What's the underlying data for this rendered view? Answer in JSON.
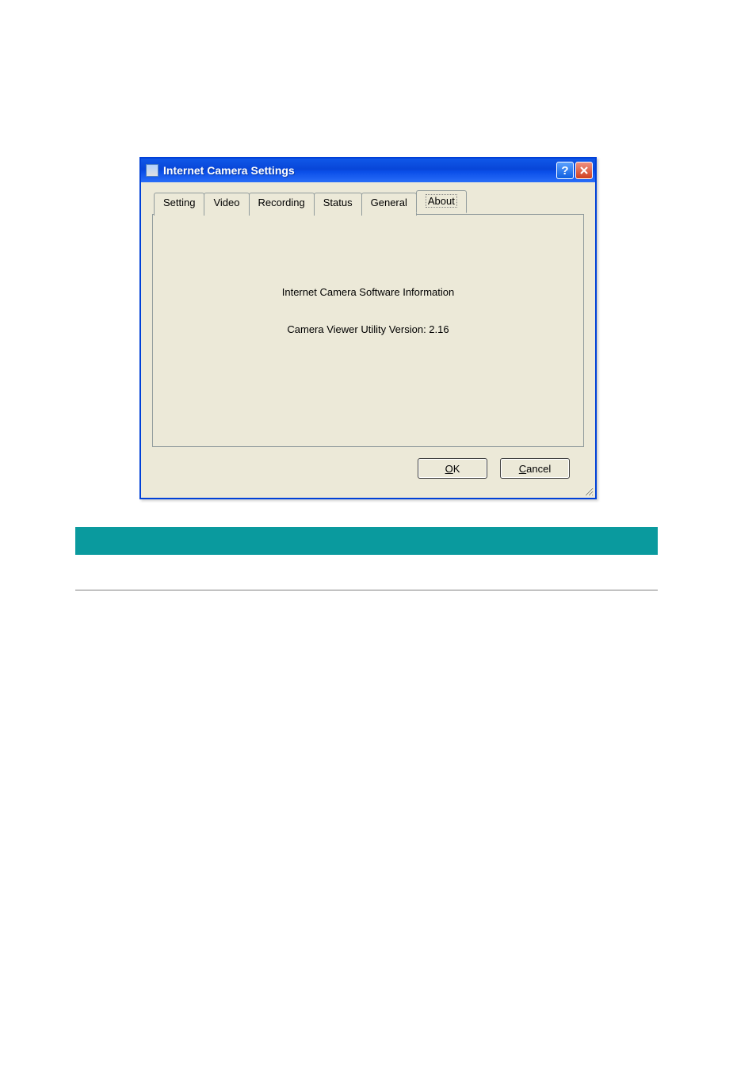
{
  "window": {
    "title": "Internet Camera Settings"
  },
  "tabs": {
    "setting": "Setting",
    "video": "Video",
    "recording": "Recording",
    "status": "Status",
    "general": "General",
    "about": "About"
  },
  "panel": {
    "line1": "Internet Camera Software Information",
    "line2": "Camera Viewer Utility Version: 2.16"
  },
  "buttons": {
    "ok_u": "O",
    "ok_rest": "K",
    "cancel_u": "C",
    "cancel_rest": "ancel"
  }
}
